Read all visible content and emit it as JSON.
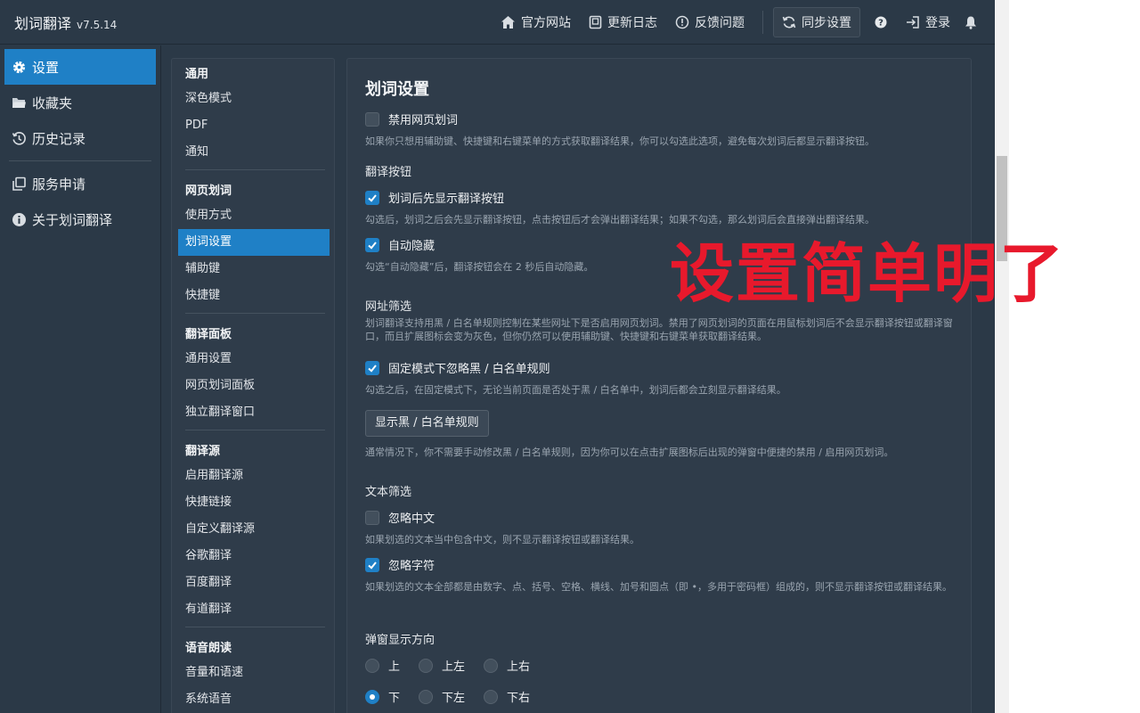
{
  "app": {
    "title": "划词翻译",
    "version": "v7.5.14"
  },
  "topnav": {
    "website": "官方网站",
    "changelog": "更新日志",
    "feedback": "反馈问题",
    "sync": "同步设置",
    "login": "登录"
  },
  "sidebar": {
    "items": [
      {
        "label": "设置",
        "icon": "gear-icon",
        "active": true
      },
      {
        "label": "收藏夹",
        "icon": "folder-icon"
      },
      {
        "label": "历史记录",
        "icon": "history-icon"
      },
      {
        "label": "服务申请",
        "icon": "copy-icon"
      },
      {
        "label": "关于划词翻译",
        "icon": "info-icon"
      }
    ]
  },
  "menu": {
    "group1": "通用",
    "g1": [
      "深色模式",
      "PDF",
      "通知"
    ],
    "group2": "网页划词",
    "g2": [
      "使用方式",
      "划词设置",
      "辅助键",
      "快捷键"
    ],
    "group3": "翻译面板",
    "g3": [
      "通用设置",
      "网页划词面板",
      "独立翻译窗口"
    ],
    "group4": "翻译源",
    "g4": [
      "启用翻译源",
      "快捷链接",
      "自定义翻译源",
      "谷歌翻译",
      "百度翻译",
      "有道翻译"
    ],
    "group5": "语音朗读",
    "g5": [
      "音量和语速",
      "系统语音"
    ]
  },
  "panel": {
    "title": "划词设置",
    "disable": {
      "label": "禁用网页划词",
      "checked": false,
      "desc": "如果你只想用辅助键、快捷键和右键菜单的方式获取翻译结果，你可以勾选此选项，避免每次划词后都显示翻译按钮。"
    },
    "btn_section": "翻译按钮",
    "show_btn": {
      "label": "划词后先显示翻译按钮",
      "checked": true,
      "desc": "勾选后，划词之后会先显示翻译按钮，点击按钮后才会弹出翻译结果；如果不勾选，那么划词后会直接弹出翻译结果。"
    },
    "auto_hide": {
      "label": "自动隐藏",
      "checked": true,
      "desc": "勾选“自动隐藏”后，翻译按钮会在 2 秒后自动隐藏。"
    },
    "url_section": "网址筛选",
    "url_desc": "划词翻译支持用黑 / 白名单规则控制在某些网址下是否启用网页划词。禁用了网页划词的页面在用鼠标划词后不会显示翻译按钮或翻译窗口，而且扩展图标会变为灰色，但你仍然可以使用辅助键、快捷键和右键菜单获取翻译结果。",
    "fixed_mode": {
      "label": "固定模式下忽略黑 / 白名单规则",
      "checked": true,
      "desc": "勾选之后，在固定模式下，无论当前页面是否处于黑 / 白名单中，划词后都会立刻显示翻译结果。"
    },
    "show_rules_btn": "显示黑 / 白名单规则",
    "rules_desc": "通常情况下，你不需要手动修改黑 / 白名单规则，因为你可以在点击扩展图标后出现的弹窗中便捷的禁用 / 启用网页划词。",
    "text_section": "文本筛选",
    "ignore_cn": {
      "label": "忽略中文",
      "checked": false,
      "desc": "如果划选的文本当中包含中文，则不显示翻译按钮或翻译结果。"
    },
    "ignore_chars": {
      "label": "忽略字符",
      "checked": true,
      "desc": "如果划选的文本全部都是由数字、点、括号、空格、横线、加号和圆点（即 •，多用于密码框）组成的，则不显示翻译按钮或翻译结果。"
    },
    "popup_section": "弹窗显示方向",
    "dir_row1": [
      "上",
      "上左",
      "上右"
    ],
    "dir_row2": [
      "下",
      "下左",
      "下右"
    ],
    "selected_direction": "下"
  },
  "overlay_text": "设置简单明了"
}
